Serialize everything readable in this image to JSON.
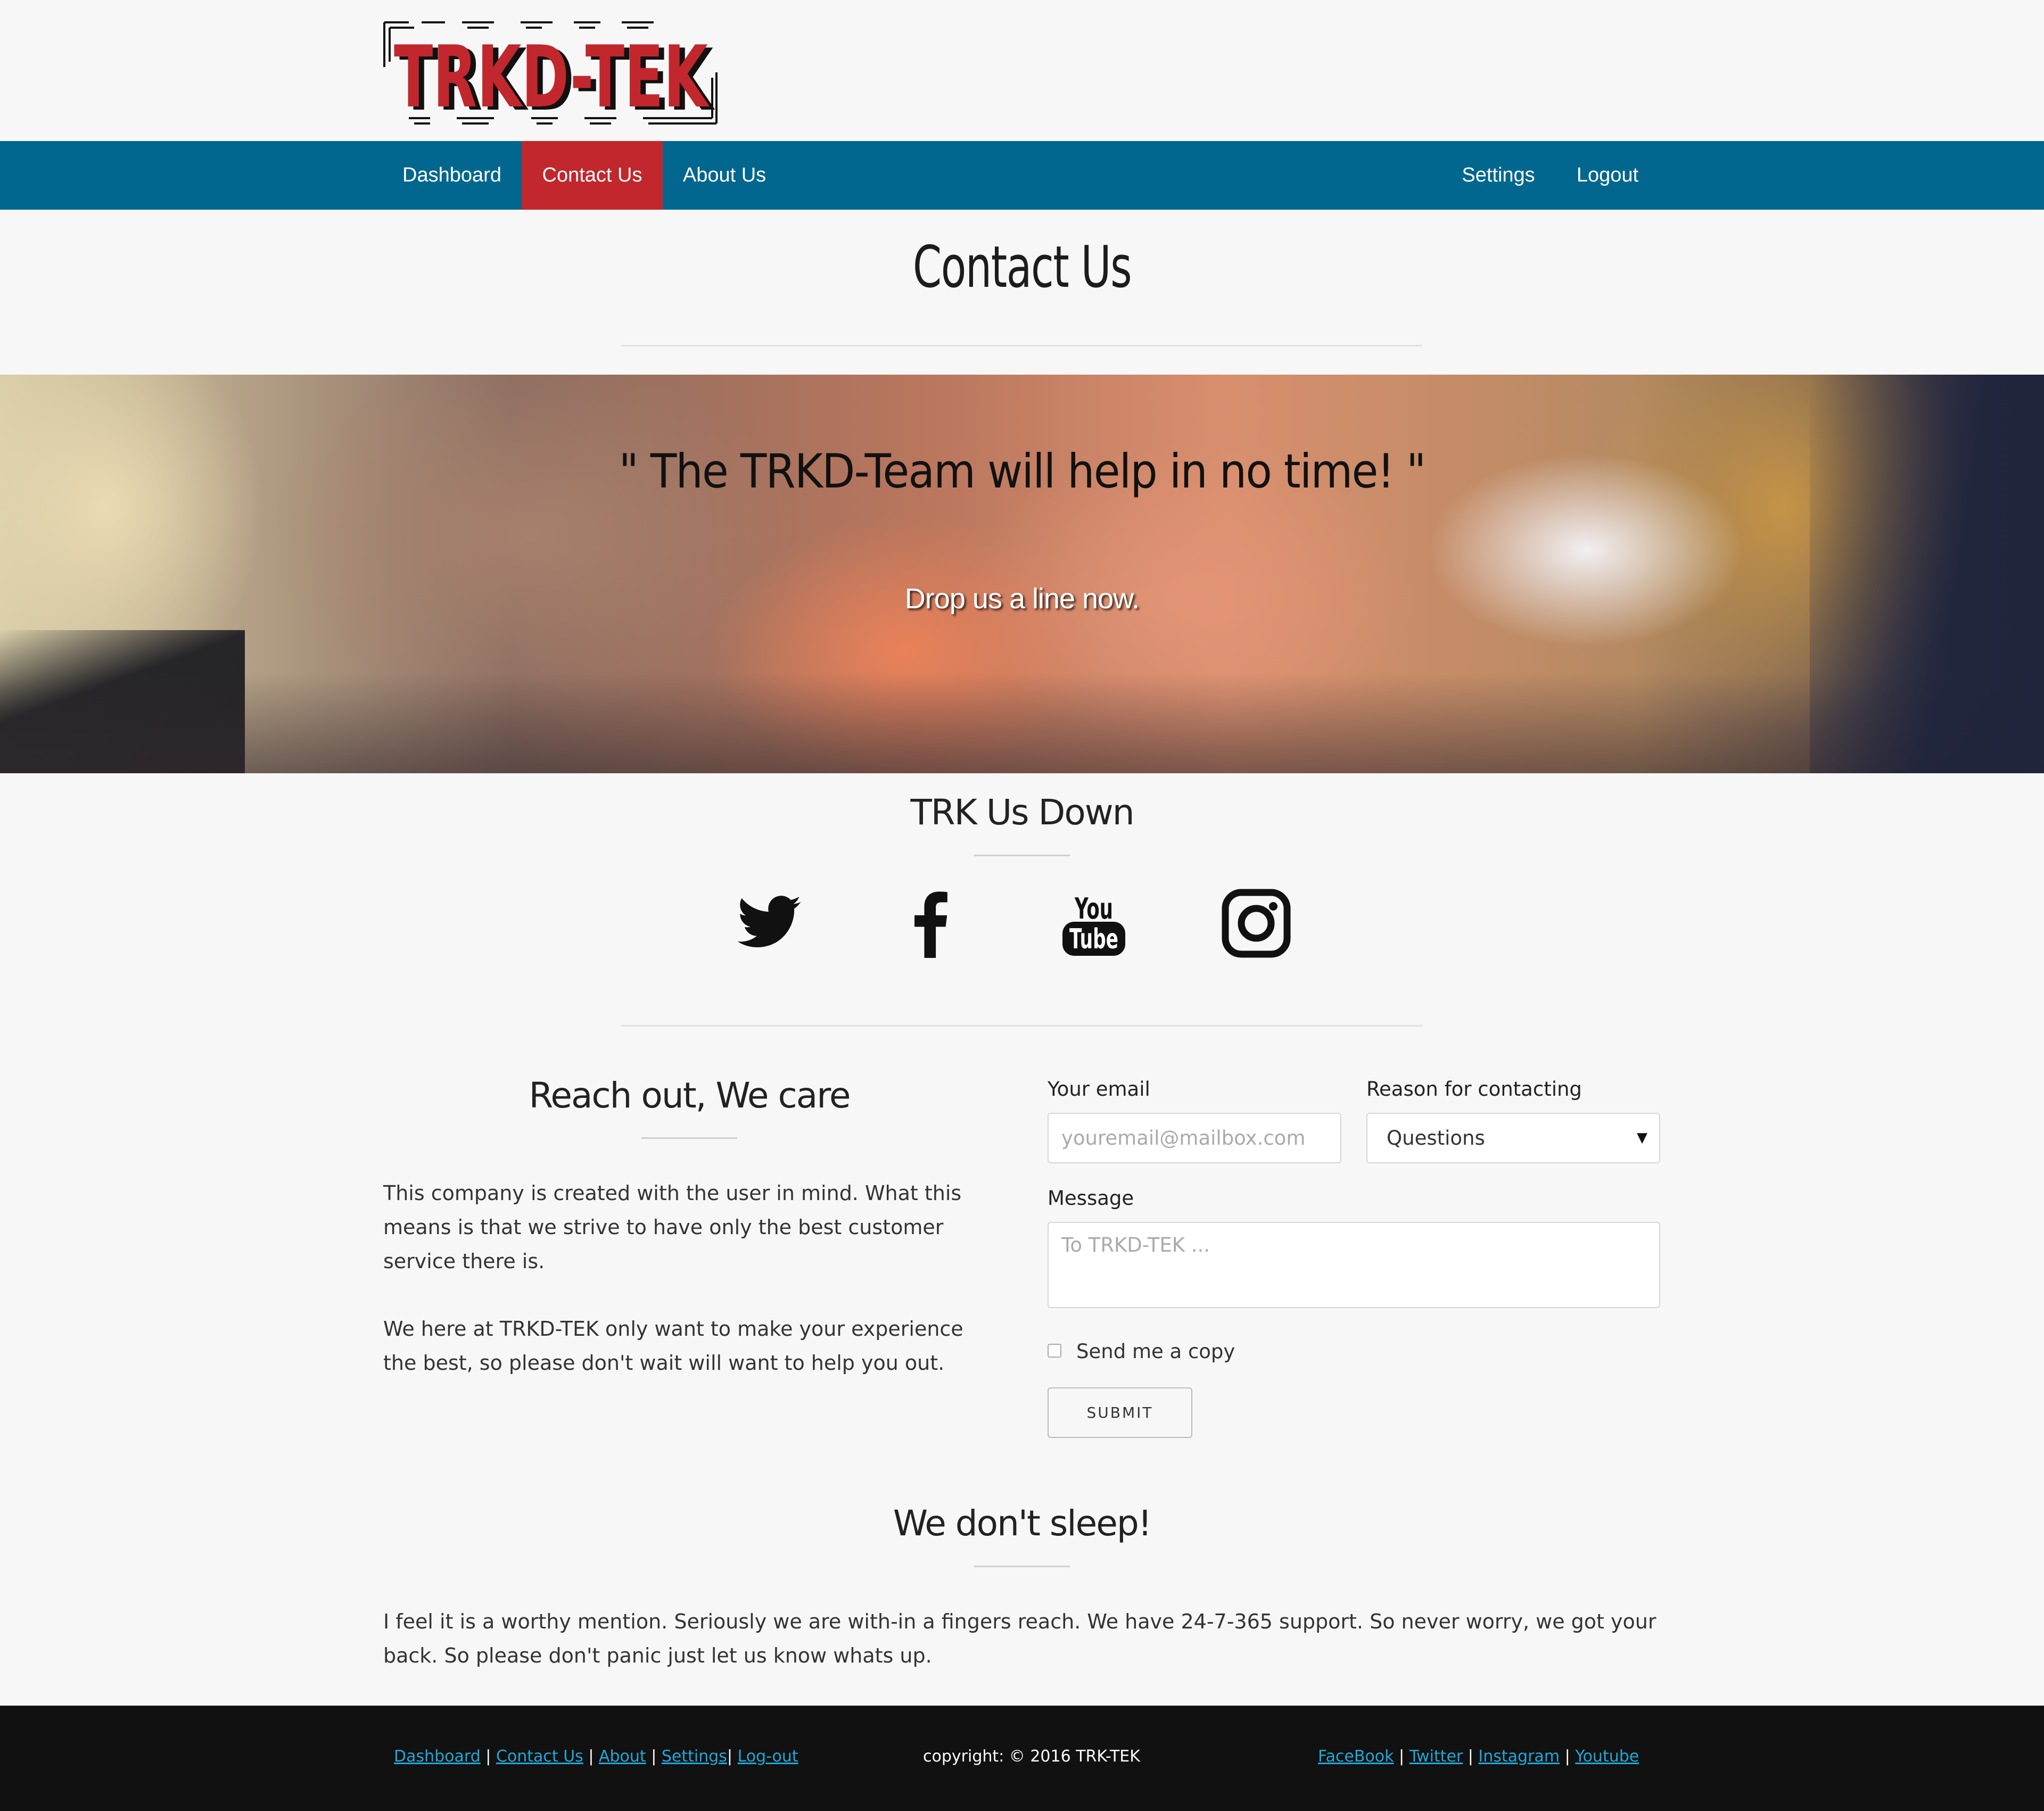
{
  "brand": {
    "logo_text": "TRKD-TEK",
    "accent": "#c1272d"
  },
  "nav": {
    "left": [
      {
        "label": "Dashboard"
      },
      {
        "label": "Contact Us",
        "active": true
      },
      {
        "label": "About Us"
      }
    ],
    "right": [
      {
        "label": "Settings"
      },
      {
        "label": "Logout"
      }
    ],
    "bar_color": "#02678f"
  },
  "page": {
    "title": "Contact Us"
  },
  "hero": {
    "quote": "\" The TRKD-Team will help in no time! \"",
    "subtitle": "Drop us a line now."
  },
  "social": {
    "heading": "TRK Us Down",
    "icons": [
      {
        "name": "twitter-icon"
      },
      {
        "name": "facebook-icon"
      },
      {
        "name": "youtube-icon",
        "text_top": "You",
        "text_bottom": "Tube"
      },
      {
        "name": "instagram-icon"
      }
    ]
  },
  "about_section": {
    "heading": "Reach out, We care",
    "paragraph1": "This company is created with the user in mind. What this means is that we strive to have only the best customer service there is.",
    "paragraph2": "We here at TRKD-TEK only want to make your experience the best, so please don't wait will want to help you out."
  },
  "form": {
    "email_label": "Your email",
    "email_placeholder": "youremail@mailbox.com",
    "reason_label": "Reason for contacting",
    "reason_selected": "Questions",
    "message_label": "Message",
    "message_placeholder": "To TRKD-TEK ...",
    "copy_label": "Send me a copy",
    "copy_checked": false,
    "submit_label": "SUBMIT"
  },
  "support": {
    "heading": "We don't sleep!",
    "text": "I feel it is a worthy mention. Seriously we are with-in a fingers reach. We have 24-7-365 support. So never worry, we got your back. So please don't panic just let us know whats up."
  },
  "footer": {
    "nav_links": [
      "Dashboard",
      "Contact Us",
      "About",
      "Settings",
      "Log-out"
    ],
    "copyright": "copyright: © 2016 TRK-TEK",
    "social_links": [
      "FaceBook",
      "Twitter",
      "Instagram",
      "Youtube"
    ],
    "link_color": "#1fa8d8"
  }
}
